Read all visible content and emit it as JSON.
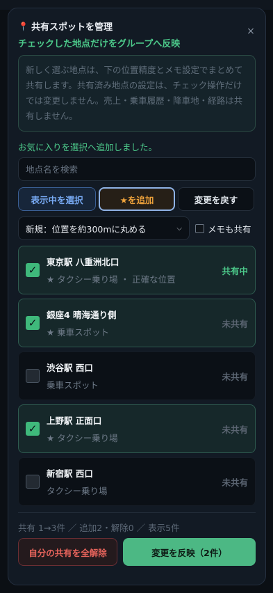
{
  "panel": {
    "title": "共有スポットを管理",
    "close_label": "×",
    "subtitle": "チェックした地点だけをグループへ反映",
    "note": "新しく選ぶ地点は、下の位置精度とメモ設定でまとめて共有します。共有済み地点の設定は、チェック操作だけでは変更しません。売上・乗車履歴・降車地・経路は共有しません。",
    "message": "お気に入りを選択へ追加しました。"
  },
  "search": {
    "placeholder": "地点名を検索",
    "value": ""
  },
  "buttons": {
    "select_visible": "表示中を選択",
    "add_star": "★を追加",
    "revert": "変更を戻す"
  },
  "precision_select": {
    "selected": "新規：位置を約300mに丸める"
  },
  "memo_share": {
    "label": "メモも共有",
    "checked": false
  },
  "items": [
    {
      "name": "東京駅 八重洲北口",
      "sub": "★ タクシー乗り場 ・ 正確な位置",
      "status": "共有中",
      "checked": true
    },
    {
      "name": "銀座4 晴海通り側",
      "sub": "★ 乗車スポット",
      "status": "未共有",
      "checked": true
    },
    {
      "name": "渋谷駅 西口",
      "sub": "乗車スポット",
      "status": "未共有",
      "checked": false
    },
    {
      "name": "上野駅 正面口",
      "sub": "★ タクシー乗り場",
      "status": "未共有",
      "checked": true
    },
    {
      "name": "新宿駅 西口",
      "sub": "タクシー乗り場",
      "status": "未共有",
      "checked": false
    }
  ],
  "summary": "共有 1→3件 ／ 追加2・解除0 ／ 表示5件",
  "footer": {
    "unshare_all": "自分の共有を全解除",
    "apply": "変更を反映（2件）"
  },
  "colors": {
    "accent_green": "#4cc98a",
    "danger": "#e5635b",
    "star": "#f0a33b",
    "blue": "#77a9f2"
  }
}
